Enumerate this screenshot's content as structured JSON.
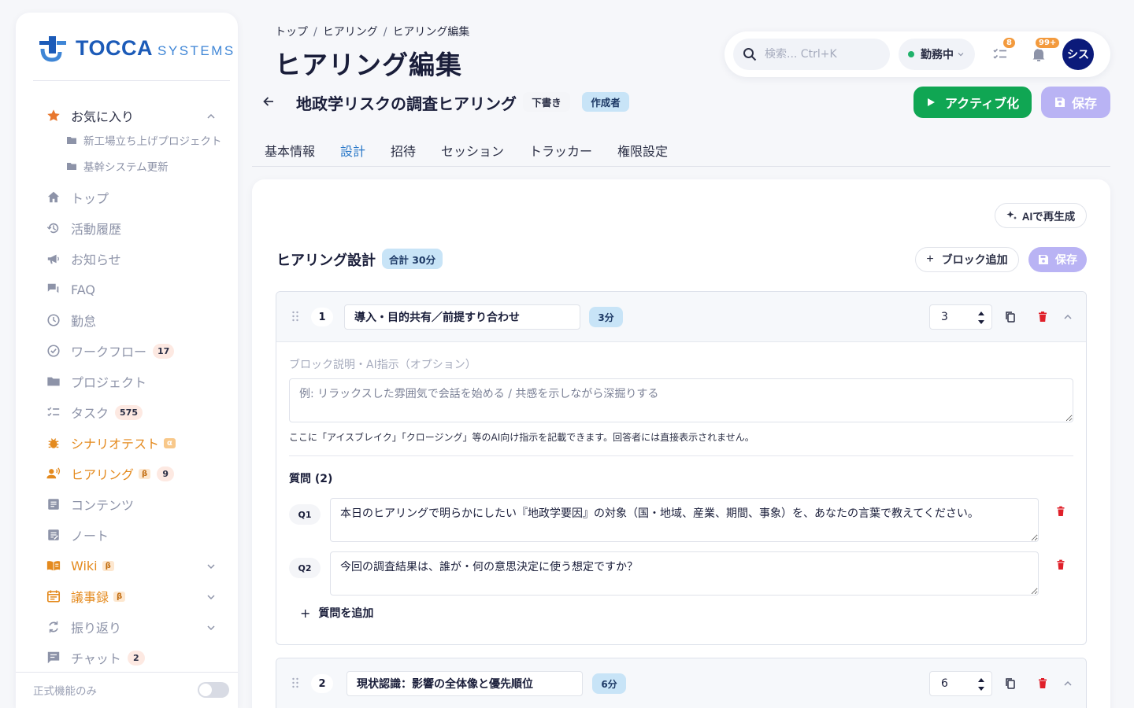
{
  "brand": {
    "name": "TOCCA",
    "suffix": "SYSTEMS"
  },
  "sidebar": {
    "favorites_label": "お気に入り",
    "favorites": [
      "新工場立ち上げプロジェクト",
      "基幹システム更新"
    ],
    "items": [
      {
        "label": "トップ"
      },
      {
        "label": "活動履歴"
      },
      {
        "label": "お知らせ"
      },
      {
        "label": "FAQ"
      },
      {
        "label": "勤怠"
      },
      {
        "label": "ワークフロー",
        "count": "17"
      },
      {
        "label": "プロジェクト"
      },
      {
        "label": "タスク",
        "count": "575"
      },
      {
        "label": "シナリオテスト",
        "tag": "α"
      },
      {
        "label": "ヒアリング",
        "tag": "β",
        "count": "9"
      },
      {
        "label": "コンテンツ"
      },
      {
        "label": "ノート"
      },
      {
        "label": "Wiki",
        "tag": "β"
      },
      {
        "label": "議事録",
        "tag": "β"
      },
      {
        "label": "振り返り"
      },
      {
        "label": "チャット",
        "count": "2"
      }
    ],
    "footer_label": "正式機能のみ"
  },
  "header": {
    "breadcrumb": [
      "トップ",
      "ヒアリング",
      "ヒアリング編集"
    ],
    "title": "ヒアリング編集",
    "search_placeholder": "検索... Ctrl+K",
    "status": "勤務中",
    "task_badge": "8",
    "notif_badge": "99+",
    "avatar": "シス"
  },
  "subheader": {
    "title": "地政学リスクの調査ヒアリング",
    "status_chip": "下書き",
    "role_chip": "作成者",
    "activate_label": "アクティブ化",
    "save_label": "保存"
  },
  "tabs": [
    "基本情報",
    "設計",
    "招待",
    "セッション",
    "トラッカー",
    "権限設定"
  ],
  "design": {
    "ai_label": "AIで再生成",
    "title": "ヒアリング設計",
    "total": "合計 30分",
    "add_block_label": "ブロック追加",
    "save_label": "保存",
    "desc_label": "ブロック説明・AI指示（オプション）",
    "desc_placeholder": "例: リラックスした雰囲気で会話を始める / 共感を示しながら深掘りする",
    "hint": "ここに「アイスブレイク」「クロージング」等のAI向け指示を記載できます。回答者には直接表示されません。",
    "questions_label": "質問 (2)",
    "add_question_label": "質問を追加",
    "blocks": [
      {
        "num": "1",
        "title": "導入・目的共有／前提すり合わせ",
        "duration": "3分",
        "minutes": "3",
        "questions": [
          {
            "label": "Q1",
            "text": "本日のヒアリングで明らかにしたい『地政学要因』の対象（国・地域、産業、期間、事象）を、あなたの言葉で教えてください。"
          },
          {
            "label": "Q2",
            "text": "今回の調査結果は、誰が・何の意思決定に使う想定ですか？"
          }
        ]
      },
      {
        "num": "2",
        "title": "現状認識：影響の全体像と優先順位",
        "duration": "6分",
        "minutes": "6"
      }
    ]
  },
  "colors": {
    "accent": "#2a78c8",
    "success": "#10a653",
    "primary_soft": "#b9b3f4",
    "orange": "#e48a1e",
    "danger": "#e0202a"
  }
}
